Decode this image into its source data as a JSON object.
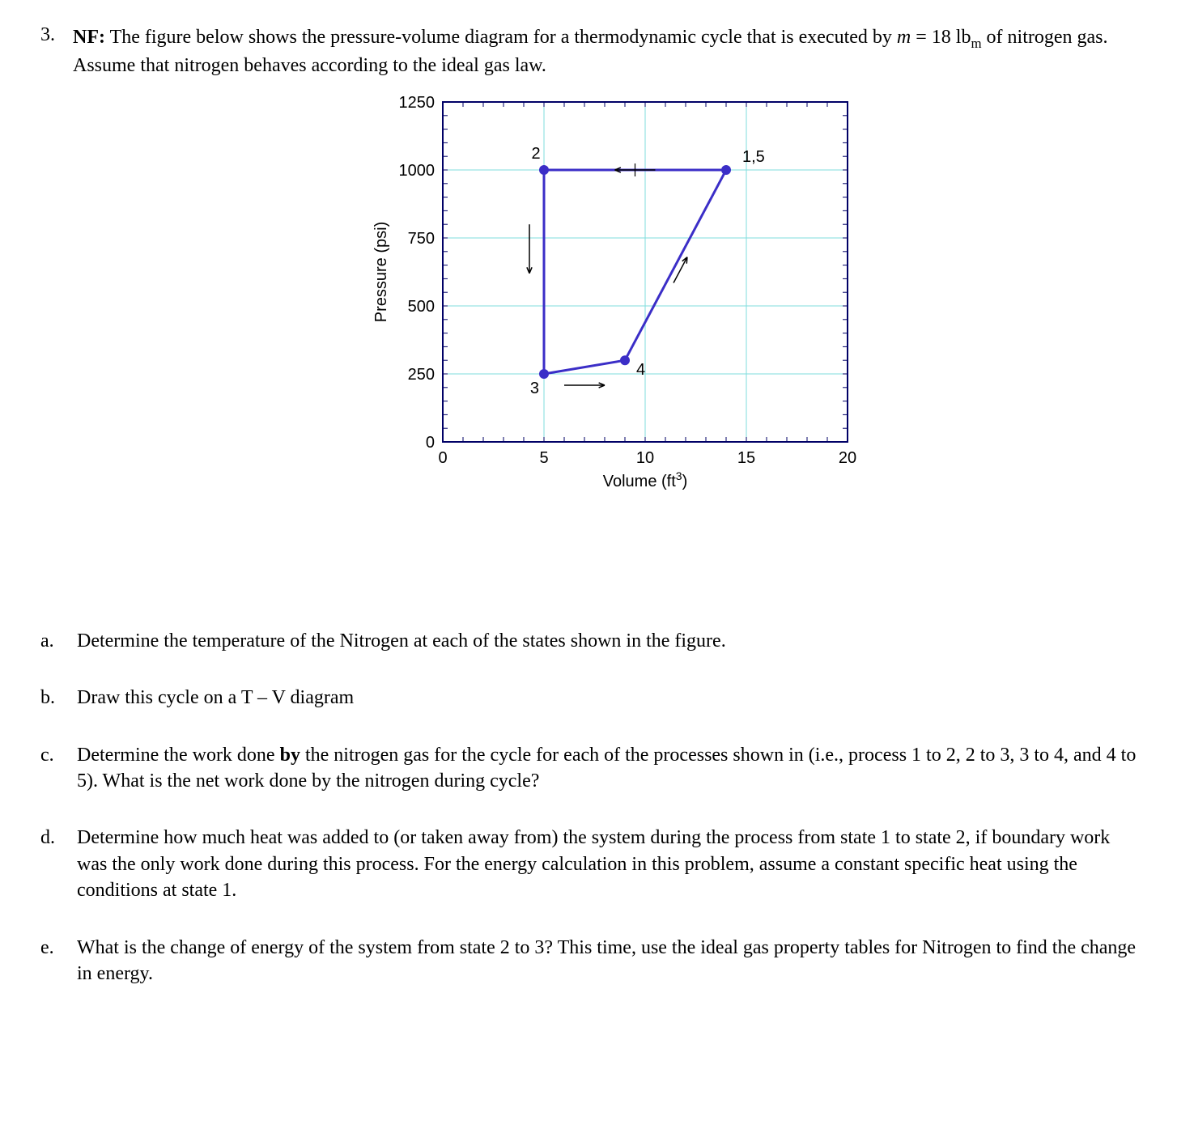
{
  "problem_number": "3.",
  "prefix": "NF:",
  "statement_part1": "The figure below shows the pressure-volume diagram for a thermodynamic cycle that is executed by ",
  "mass_var": "m",
  "equals": " = ",
  "mass_val": "18 lb",
  "mass_unit_sub": "m",
  "statement_part2": " of nitrogen gas. Assume that nitrogen behaves according to the ideal gas law.",
  "chart_data": {
    "type": "line",
    "title": "",
    "xlabel": "Volume (ft³)",
    "ylabel": "Pressure (psi)",
    "xlim": [
      0,
      20
    ],
    "ylim": [
      0,
      1250
    ],
    "xticks": [
      0,
      5,
      10,
      15,
      20
    ],
    "yticks": [
      0,
      250,
      500,
      750,
      1000,
      1250
    ],
    "grid": true,
    "states": [
      {
        "id": "1,5",
        "V": 14,
        "P": 1000
      },
      {
        "id": "2",
        "V": 5,
        "P": 1000
      },
      {
        "id": "3",
        "V": 5,
        "P": 250
      },
      {
        "id": "4",
        "V": 9,
        "P": 300
      }
    ],
    "processes": [
      {
        "from": "1,5",
        "to": "2",
        "path": "straight"
      },
      {
        "from": "2",
        "to": "3",
        "path": "straight"
      },
      {
        "from": "3",
        "to": "4",
        "path": "straight"
      },
      {
        "from": "4",
        "to": "1,5",
        "path": "straight"
      }
    ]
  },
  "q_a_label": "a.",
  "q_a_text": "Determine the temperature of the Nitrogen at each of the states shown in the figure.",
  "q_b_label": "b.",
  "q_b_text": "Draw this cycle on a T – V diagram",
  "q_c_label": "c.",
  "q_c_text_1": "Determine the work done ",
  "q_c_bold": "by",
  "q_c_text_2": " the nitrogen gas for the cycle for each of the processes shown in (i.e., process 1 to 2, 2 to 3, 3 to 4, and 4 to 5). What is the net work done by the nitrogen during cycle?",
  "q_d_label": "d.",
  "q_d_text": "Determine how much heat was added to (or taken away from) the system during the process from state 1 to state 2, if boundary work was the only work done during this process. For the energy calculation in this problem, assume a constant specific heat using the conditions at state 1.",
  "q_e_label": "e.",
  "q_e_text": "What is the change of energy of the system from state 2 to 3?  This time, use the ideal gas property tables for Nitrogen to find the change in energy."
}
